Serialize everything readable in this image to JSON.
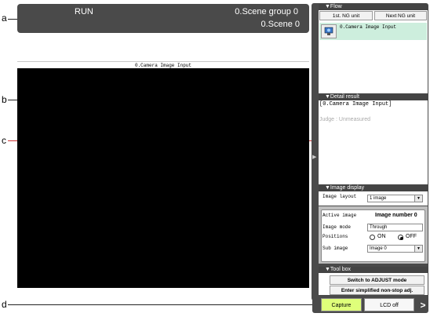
{
  "callouts": {
    "a": "a",
    "b": "b",
    "c": "c",
    "d": "d"
  },
  "status": {
    "mode": "RUN",
    "scene_group": "0.Scene group 0",
    "scene": "0.Scene 0"
  },
  "image_panel": {
    "title": "0.Camera Image Input"
  },
  "flow": {
    "header": "▼Flow",
    "first_ng_button": "1st. NG unit",
    "next_ng_button": "Next NG unit",
    "items": [
      {
        "label": "0.Camera Image Input"
      }
    ]
  },
  "detail": {
    "header": "▼Detail result",
    "unit": "[0.Camera Image Input]",
    "judge": "Judge : Unmeasured"
  },
  "image_display": {
    "header": "▼Image display",
    "layout_label": "Image layout",
    "layout_value": "1 image",
    "active_image_label": "Active image",
    "active_image_value": "Image number 0",
    "image_mode_label": "Image mode",
    "image_mode_value": "Through",
    "positions_label": "Positions",
    "on_label": "ON",
    "off_label": "OFF",
    "positions_selected": "OFF",
    "sub_image_label": "Sub image",
    "sub_image_value": "Image 0"
  },
  "toolbox": {
    "header": "▼Tool box",
    "adjust_button": "Switch to ADJUST mode",
    "nonstop_button": "Enter simplified non-stop adj."
  },
  "bottom": {
    "capture_button": "Capture",
    "lcd_button": "LCD off",
    "next_arrow": ">"
  },
  "colors": {
    "dark": "#4a4a4a",
    "capture_accent": "#dfff7a",
    "flow_item": "#cdeedd"
  }
}
